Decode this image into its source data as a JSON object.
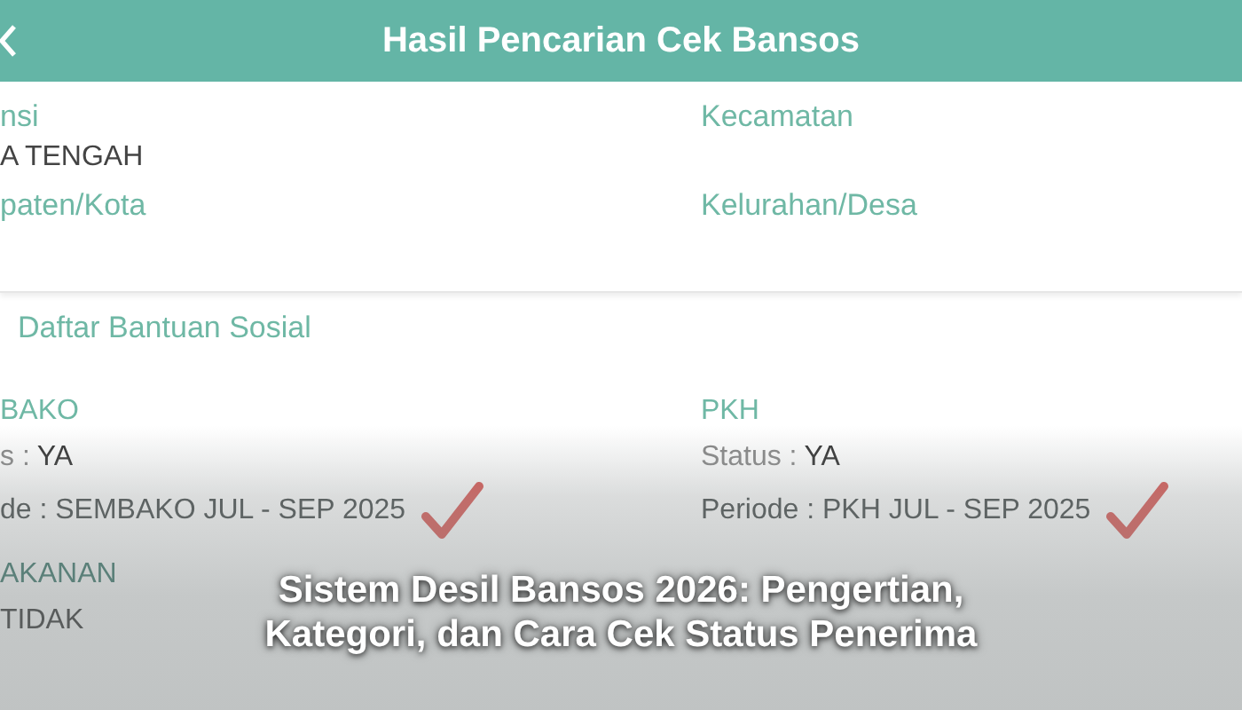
{
  "header": {
    "title": "Hasil Pencarian Cek Bansos"
  },
  "location_fields": [
    {
      "label": "nsi",
      "value": "A TENGAH"
    },
    {
      "label": "Kecamatan"
    },
    {
      "label": "paten/Kota"
    },
    {
      "label": "Kelurahan/Desa"
    }
  ],
  "section_title": "Daftar Bantuan Sosial",
  "aid_items": [
    {
      "name": "BAKO",
      "status_label": "s :",
      "status_value": "YA",
      "period": "de : SEMBAKO JUL - SEP 2025",
      "checked": true
    },
    {
      "name": "PKH",
      "status_label": "Status :",
      "status_value": "YA",
      "period": "Periode : PKH JUL - SEP 2025",
      "checked": true
    },
    {
      "name": "AKANAN",
      "status_value": "TIDAK"
    }
  ],
  "caption": [
    "Sistem Desil Bansos 2026: Pengertian,",
    "Kategori, dan Cara Cek Status Penerima"
  ]
}
